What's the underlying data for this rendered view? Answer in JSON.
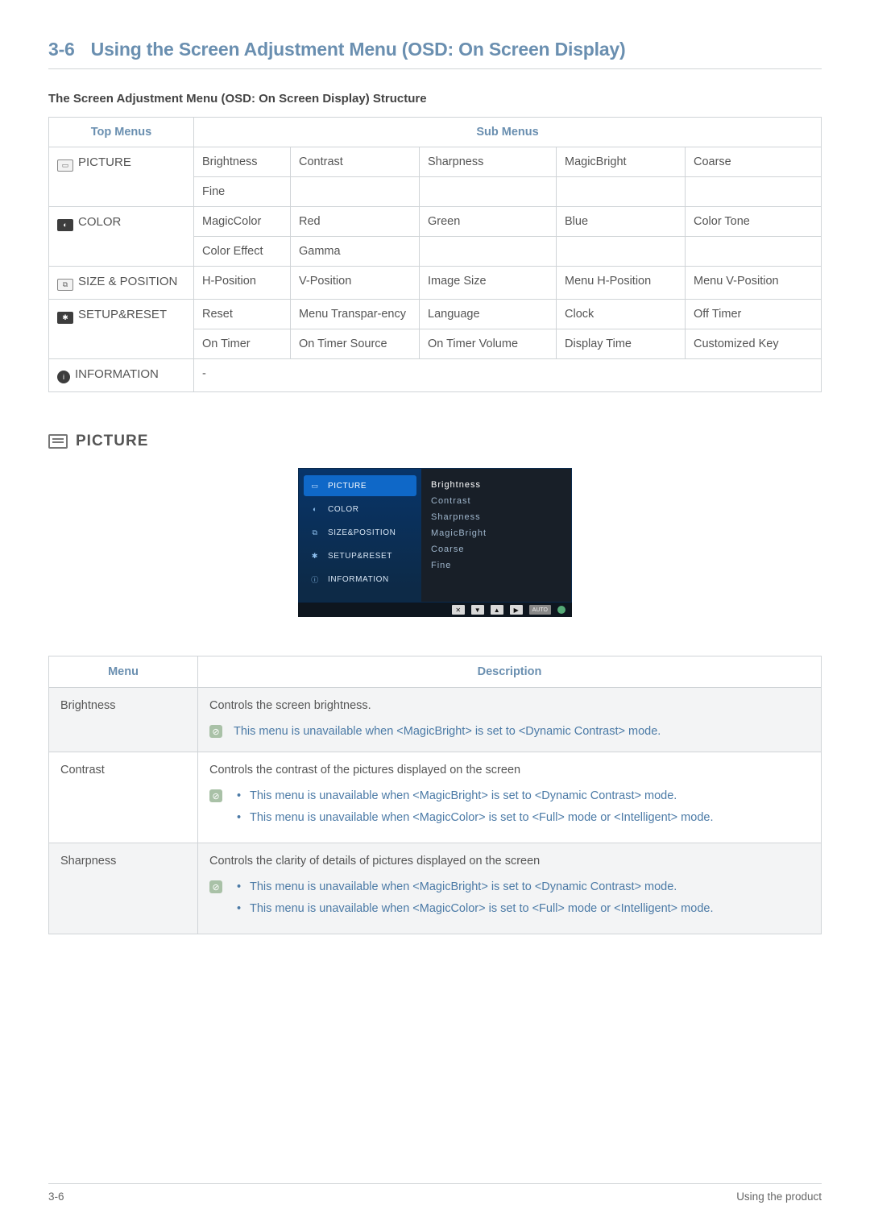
{
  "page": {
    "chapter_number": "3-6",
    "title": "Using the Screen Adjustment Menu (OSD: On Screen Display)",
    "footer_left": "3-6",
    "footer_right": "Using the product"
  },
  "structure_heading": "The Screen Adjustment Menu (OSD: On Screen Display) Structure",
  "structure_table": {
    "headers": {
      "top": "Top Menus",
      "sub": "Sub Menus"
    },
    "rows": [
      {
        "icon": "picture-icon",
        "top": "PICTURE",
        "sub_rows": [
          [
            "Brightness",
            "Contrast",
            "Sharpness",
            "MagicBright",
            "Coarse"
          ],
          [
            "Fine",
            "",
            "",
            "",
            ""
          ]
        ]
      },
      {
        "icon": "color-icon",
        "top": "COLOR",
        "sub_rows": [
          [
            "MagicColor",
            "Red",
            "Green",
            "Blue",
            "Color Tone"
          ],
          [
            "Color Effect",
            "Gamma",
            "",
            "",
            ""
          ]
        ]
      },
      {
        "icon": "size-icon",
        "top": "SIZE & POSITION",
        "sub_rows": [
          [
            "H-Position",
            "V-Position",
            "Image Size",
            "Menu H-Position",
            "Menu V-Position"
          ]
        ]
      },
      {
        "icon": "setup-icon",
        "top": "SETUP&RESET",
        "sub_rows": [
          [
            "Reset",
            "Menu Transpar-ency",
            "Language",
            "Clock",
            "Off Timer"
          ],
          [
            "On Timer",
            "On Timer Source",
            "On Timer Volume",
            "Display Time",
            "Customized Key"
          ]
        ]
      },
      {
        "icon": "info-icon",
        "top": "INFORMATION",
        "sub_rows": [
          [
            "-",
            "",
            "",
            "",
            ""
          ]
        ]
      }
    ]
  },
  "picture_section": {
    "heading": "PICTURE",
    "osd": {
      "left_items": [
        {
          "label": "PICTURE",
          "selected": true
        },
        {
          "label": "COLOR",
          "selected": false
        },
        {
          "label": "SIZE&POSITION",
          "selected": false
        },
        {
          "label": "SETUP&RESET",
          "selected": false
        },
        {
          "label": "INFORMATION",
          "selected": false
        }
      ],
      "right_items": [
        {
          "label": "Brightness",
          "selected": true
        },
        {
          "label": "Contrast",
          "selected": false
        },
        {
          "label": "Sharpness",
          "selected": false
        },
        {
          "label": "MagicBright",
          "selected": false
        },
        {
          "label": "Coarse",
          "selected": false
        },
        {
          "label": "Fine",
          "selected": false
        }
      ],
      "footer_auto": "AUTO"
    }
  },
  "desc_table": {
    "headers": {
      "menu": "Menu",
      "desc": "Description"
    },
    "rows": [
      {
        "menu": "Brightness",
        "desc_intro": "Controls the screen brightness.",
        "notes_flat": "This menu is unavailable when <MagicBright> is set to <Dynamic Contrast> mode.",
        "alt": true
      },
      {
        "menu": "Contrast",
        "desc_intro": "Controls the contrast of the pictures displayed on the screen",
        "notes_list": [
          "This menu is unavailable when <MagicBright> is set to <Dynamic Contrast> mode.",
          "This menu is unavailable when <MagicColor> is set to <Full> mode or <Intelligent> mode."
        ],
        "alt": false
      },
      {
        "menu": "Sharpness",
        "desc_intro": "Controls the clarity of details of pictures displayed on the screen",
        "notes_list": [
          "This menu is unavailable when <MagicBright> is set to <Dynamic Contrast> mode.",
          "This menu is unavailable when <MagicColor> is set to <Full> mode or <Intelligent> mode."
        ],
        "alt": true
      }
    ]
  }
}
